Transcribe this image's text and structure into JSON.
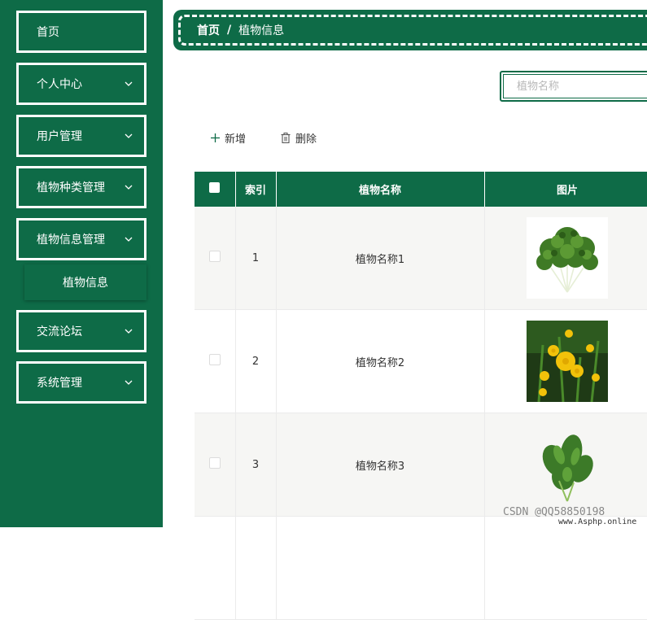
{
  "sidebar": {
    "items": [
      {
        "label": "首页",
        "has_chevron": false
      },
      {
        "label": "个人中心",
        "has_chevron": true
      },
      {
        "label": "用户管理",
        "has_chevron": true
      },
      {
        "label": "植物种类管理",
        "has_chevron": true
      },
      {
        "label": "植物信息管理",
        "has_chevron": true
      },
      {
        "label": "交流论坛",
        "has_chevron": true
      },
      {
        "label": "系统管理",
        "has_chevron": true
      }
    ],
    "submenu": {
      "label": "植物信息"
    }
  },
  "breadcrumb": {
    "home": "首页",
    "separator": "/",
    "current": "植物信息"
  },
  "search": {
    "placeholder": "植物名称",
    "value": ""
  },
  "toolbar": {
    "add_label": "新增",
    "delete_label": "删除"
  },
  "table": {
    "columns": [
      "索引",
      "植物名称",
      "图片"
    ],
    "rows": [
      {
        "index": "1",
        "name": "植物名称1",
        "image": "leafy-greens-photo"
      },
      {
        "index": "2",
        "name": "植物名称2",
        "image": "yellow-flowers-photo"
      },
      {
        "index": "3",
        "name": "植物名称3",
        "image": "spinach-bunch-photo"
      }
    ]
  },
  "watermark": {
    "text": "CSDN @QQ58850198",
    "site": "www.Asphp.online"
  },
  "colors": {
    "brand": "#0e6b47",
    "stripe": "#f6f6f4"
  }
}
